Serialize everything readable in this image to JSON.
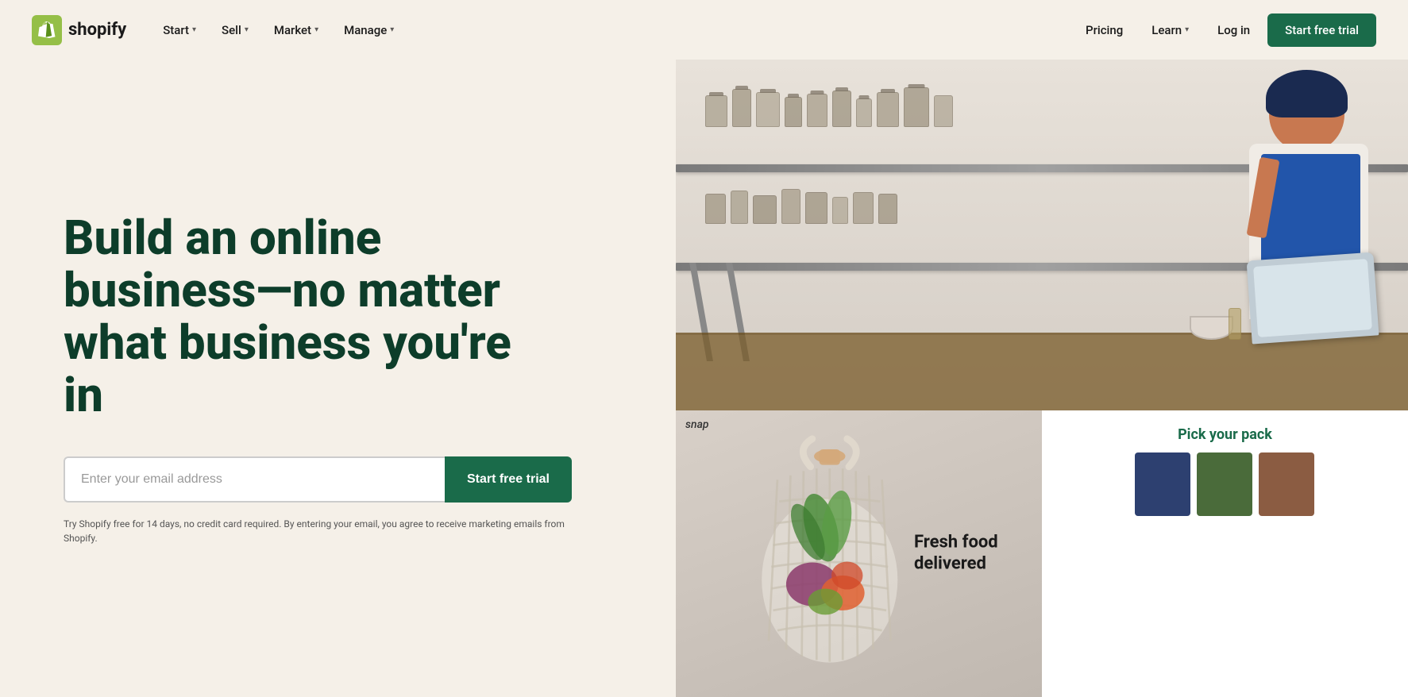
{
  "brand": {
    "name": "shopify",
    "logo_text": "shopify"
  },
  "nav": {
    "items_left": [
      {
        "label": "Start",
        "has_dropdown": true
      },
      {
        "label": "Sell",
        "has_dropdown": true
      },
      {
        "label": "Market",
        "has_dropdown": true
      },
      {
        "label": "Manage",
        "has_dropdown": true
      }
    ],
    "items_right": [
      {
        "label": "Pricing",
        "has_dropdown": false
      },
      {
        "label": "Learn",
        "has_dropdown": true
      }
    ],
    "login_label": "Log in",
    "cta_label": "Start free trial"
  },
  "hero": {
    "heading": "Build an online business—no matter what business you're in",
    "email_placeholder": "Enter your email address",
    "cta_label": "Start free trial",
    "disclaimer": "Try Shopify free for 14 days, no credit card required. By entering your email, you agree to receive marketing emails from Shopify."
  },
  "collage": {
    "snap_label": "snap",
    "fresh_food_title_line1": "Fresh food",
    "fresh_food_title_line2": "delivered",
    "pick_pack_label": "Pick your pack",
    "swatches": [
      "#2d4070",
      "#4a6b3a",
      "#8b5c42"
    ]
  }
}
